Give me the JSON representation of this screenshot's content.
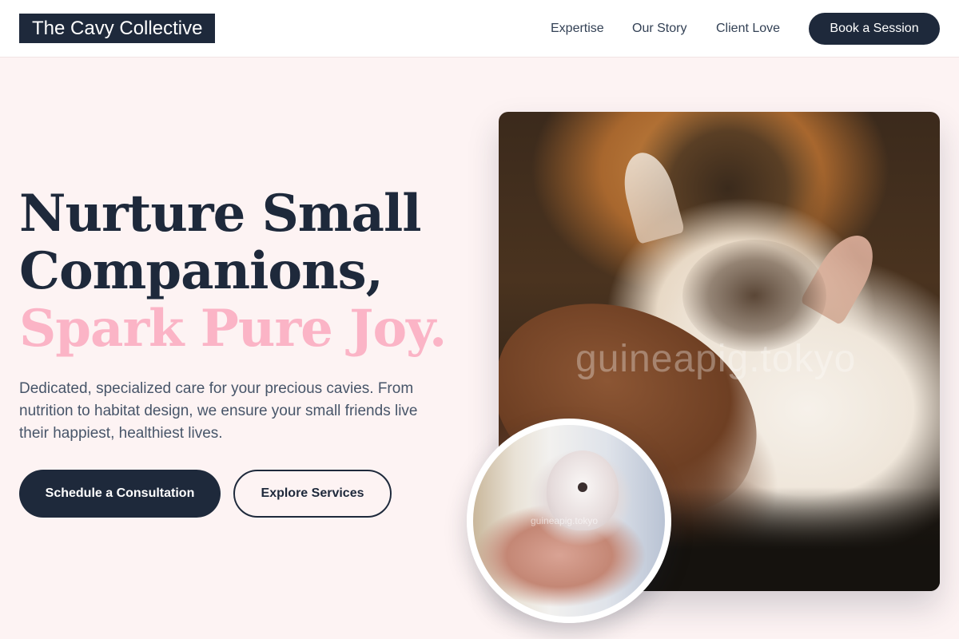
{
  "header": {
    "logo": "The Cavy Collective",
    "nav": [
      "Expertise",
      "Our Story",
      "Client Love"
    ],
    "cta": "Book a Session"
  },
  "hero": {
    "headline_line1": "Nurture Small",
    "headline_line2": "Companions,",
    "headline_accent": "Spark Pure Joy.",
    "description": "Dedicated, specialized care for your precious cavies. From nutrition to habitat design, we ensure your small friends live their happiest, healthiest lives.",
    "primary_button": "Schedule a Consultation",
    "secondary_button": "Explore Services"
  },
  "images": {
    "main_watermark": "guineapig.tokyo",
    "inset_watermark": "guineapig.tokyo"
  },
  "colors": {
    "primary": "#1e293b",
    "accent_pink": "#fbb4c6",
    "background": "#fdf3f3",
    "text_muted": "#475569"
  }
}
